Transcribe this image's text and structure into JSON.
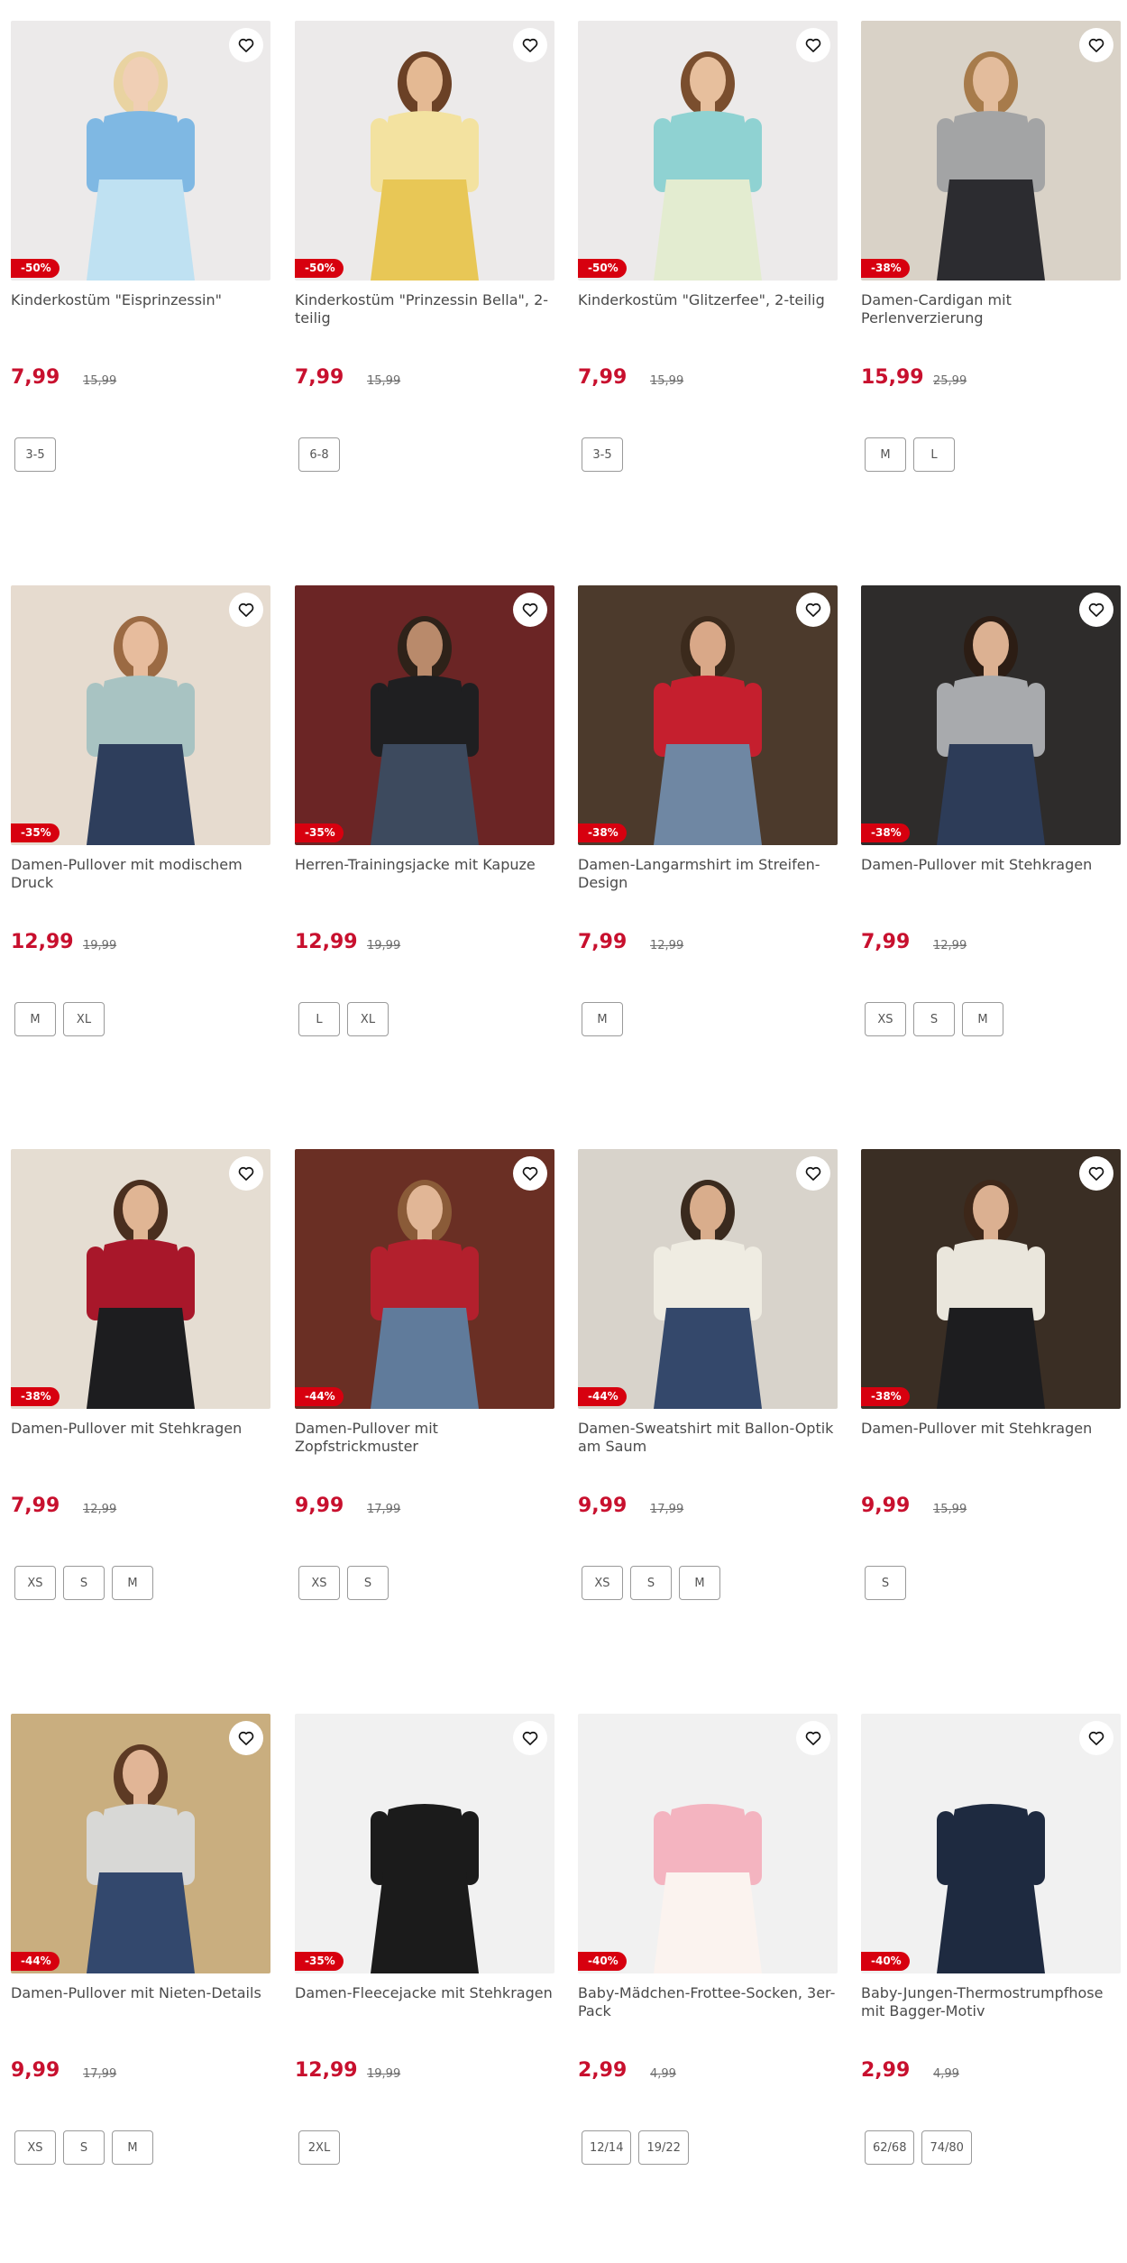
{
  "products": [
    {
      "title": "Kinderkostüm \"Eisprinzessin\"",
      "discount": "-50%",
      "price": "7,99",
      "old_price": "15,99",
      "sizes": [
        "3-5"
      ],
      "image": {
        "bg": "#eceaea",
        "top": "#7fb8e3",
        "bottom": "#bfe1f2",
        "skin": "#f0cfb5",
        "hair": "#e9d3a1"
      }
    },
    {
      "title": "Kinderkostüm \"Prinzessin Bella\", 2-teilig",
      "discount": "-50%",
      "price": "7,99",
      "old_price": "15,99",
      "sizes": [
        "6-8"
      ],
      "image": {
        "bg": "#eceaea",
        "top": "#f3e2a0",
        "bottom": "#e8c756",
        "skin": "#e4b993",
        "hair": "#6b4126"
      }
    },
    {
      "title": "Kinderkostüm \"Glitzerfee\", 2-teilig",
      "discount": "-50%",
      "price": "7,99",
      "old_price": "15,99",
      "sizes": [
        "3-5"
      ],
      "image": {
        "bg": "#eceaea",
        "top": "#8fd2d2",
        "bottom": "#e3ecd0",
        "skin": "#e7bf9d",
        "hair": "#7a4e2e"
      }
    },
    {
      "title": "Damen-Cardigan mit Perlenverzierung",
      "discount": "-38%",
      "price": "15,99",
      "old_price": "25,99",
      "sizes": [
        "M",
        "L"
      ],
      "image": {
        "bg": "#d9d2c7",
        "top": "#a3a4a5",
        "bottom": "#2c2c30",
        "skin": "#e3bc9c",
        "hair": "#a77b4b"
      }
    },
    {
      "title": "Damen-Pullover mit modischem Druck",
      "discount": "-35%",
      "price": "12,99",
      "old_price": "19,99",
      "sizes": [
        "M",
        "XL"
      ],
      "image": {
        "bg": "#e6dbcf",
        "top": "#a8c3c2",
        "bottom": "#2e3e5c",
        "skin": "#e7bc9d",
        "hair": "#9b6a43"
      }
    },
    {
      "title": "Herren-Trainingsjacke mit Kapuze",
      "discount": "-35%",
      "price": "12,99",
      "old_price": "19,99",
      "sizes": [
        "L",
        "XL"
      ],
      "image": {
        "bg": "#6b2525",
        "top": "#1f1f21",
        "bottom": "#3d4a5e",
        "skin": "#b98a6b",
        "hair": "#2e2219"
      }
    },
    {
      "title": "Damen-Langarmshirt im Streifen-Design",
      "discount": "-38%",
      "price": "7,99",
      "old_price": "12,99",
      "sizes": [
        "M"
      ],
      "image": {
        "bg": "#4c3a2c",
        "top": "#c51f2e",
        "bottom": "#6f87a3",
        "skin": "#d9a888",
        "hair": "#3b2a1c"
      }
    },
    {
      "title": "Damen-Pullover mit Stehkragen",
      "discount": "-38%",
      "price": "7,99",
      "old_price": "12,99",
      "sizes": [
        "XS",
        "S",
        "M"
      ],
      "image": {
        "bg": "#2e2c2b",
        "top": "#a8aaad",
        "bottom": "#2d3c58",
        "skin": "#dcb192",
        "hair": "#2c1d14"
      }
    },
    {
      "title": "Damen-Pullover mit Stehkragen",
      "discount": "-38%",
      "price": "7,99",
      "old_price": "12,99",
      "sizes": [
        "XS",
        "S",
        "M"
      ],
      "image": {
        "bg": "#e5ddd2",
        "top": "#a8172a",
        "bottom": "#1d1d1f",
        "skin": "#e0b594",
        "hair": "#4a2f1f"
      }
    },
    {
      "title": "Damen-Pullover mit Zopfstrickmuster",
      "discount": "-44%",
      "price": "9,99",
      "old_price": "17,99",
      "sizes": [
        "XS",
        "S"
      ],
      "image": {
        "bg": "#6a2f24",
        "top": "#b3202d",
        "bottom": "#607b9b",
        "skin": "#e1b696",
        "hair": "#8a5b38"
      }
    },
    {
      "title": "Damen-Sweatshirt mit Ballon-Optik am Saum",
      "discount": "-44%",
      "price": "9,99",
      "old_price": "17,99",
      "sizes": [
        "XS",
        "S",
        "M"
      ],
      "image": {
        "bg": "#d8d3cb",
        "top": "#efece2",
        "bottom": "#34486b",
        "skin": "#d9ad8c",
        "hair": "#3a2a1e"
      }
    },
    {
      "title": "Damen-Pullover mit Stehkragen",
      "discount": "-38%",
      "price": "9,99",
      "old_price": "15,99",
      "sizes": [
        "S"
      ],
      "image": {
        "bg": "#3a2e24",
        "top": "#eae6dc",
        "bottom": "#1d1d1f",
        "skin": "#dbb091",
        "hair": "#3d2719"
      }
    },
    {
      "title": "Damen-Pullover mit Nieten-Details",
      "discount": "-44%",
      "price": "9,99",
      "old_price": "17,99",
      "sizes": [
        "XS",
        "S",
        "M"
      ],
      "image": {
        "bg": "#c9ae7f",
        "top": "#d8d8d6",
        "bottom": "#33486d",
        "skin": "#e1b596",
        "hair": "#5d3a24"
      }
    },
    {
      "title": "Damen-Fleecejacke mit Stehkragen",
      "discount": "-35%",
      "price": "12,99",
      "old_price": "19,99",
      "sizes": [
        "2XL"
      ],
      "image": {
        "bg": "#f1f1f1",
        "top": "#1b1b1b",
        "bottom": "#1b1b1b",
        "skin": "#f1f1f1",
        "hair": "#f1f1f1"
      }
    },
    {
      "title": "Baby-Mädchen-Frottee-Socken, 3er-Pack",
      "discount": "-40%",
      "price": "2,99",
      "old_price": "4,99",
      "sizes": [
        "12/14",
        "19/22"
      ],
      "image": {
        "bg": "#f1f1f1",
        "top": "#f4b4c0",
        "bottom": "#fbf3ef",
        "skin": "#f1f1f1",
        "hair": "#f1f1f1"
      }
    },
    {
      "title": "Baby-Jungen-Thermostrumpfhose mit Bagger-Motiv",
      "discount": "-40%",
      "price": "2,99",
      "old_price": "4,99",
      "sizes": [
        "62/68",
        "74/80"
      ],
      "image": {
        "bg": "#f1f1f1",
        "top": "#1e2a40",
        "bottom": "#1e2a40",
        "skin": "#f1f1f1",
        "hair": "#f1f1f1"
      }
    }
  ]
}
